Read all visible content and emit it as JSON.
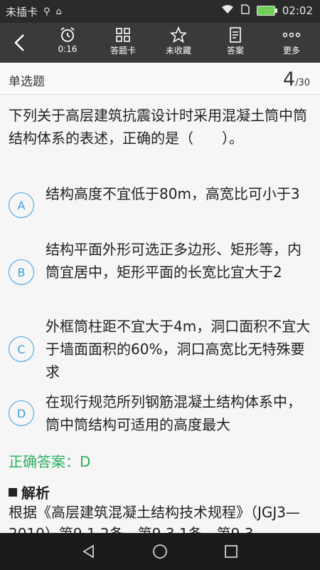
{
  "status_bar": {
    "carrier": "未插卡",
    "time": "02:02"
  },
  "toolbar": {
    "back_icon": "back-arrow-icon",
    "items": [
      {
        "icon": "alarm-clock-icon",
        "label": "0:16"
      },
      {
        "icon": "grid-icon",
        "label": "答题卡"
      },
      {
        "icon": "star-icon",
        "label": "未收藏"
      },
      {
        "icon": "document-icon",
        "label": "答案"
      },
      {
        "icon": "more-dots-icon",
        "label": "更多"
      }
    ]
  },
  "question": {
    "type": "单选题",
    "current": "4",
    "total": "/30",
    "text": "下列关于高层建筑抗震设计时采用混凝土筒中筒结构体系的表述，正确的是（　　）。",
    "options": [
      {
        "letter": "A",
        "text": "结构高度不宜低于80m，高宽比可小于3"
      },
      {
        "letter": "B",
        "text": "结构平面外形可选正多边形、矩形等，内筒宜居中，矩形平面的长宽比宜大于2"
      },
      {
        "letter": "C",
        "text": "外框筒柱距不宜大于4m，洞口面积不宜大于墙面面积的60%，洞口高宽比无特殊要求"
      },
      {
        "letter": "D",
        "text": "在现行规范所列钢筋混凝土结构体系中，筒中筒结构可适用的高度最大"
      }
    ],
    "correct_answer": "正确答案：D",
    "analysis_title": "解析",
    "analysis_text": "根据《高层建筑混凝土结构技术规程》（JGJ3—2010）第9.1.2条、第9.3.1条、第9.3"
  },
  "colors": {
    "accent": "#3aa0e0",
    "answer_green": "#2ab05e"
  }
}
